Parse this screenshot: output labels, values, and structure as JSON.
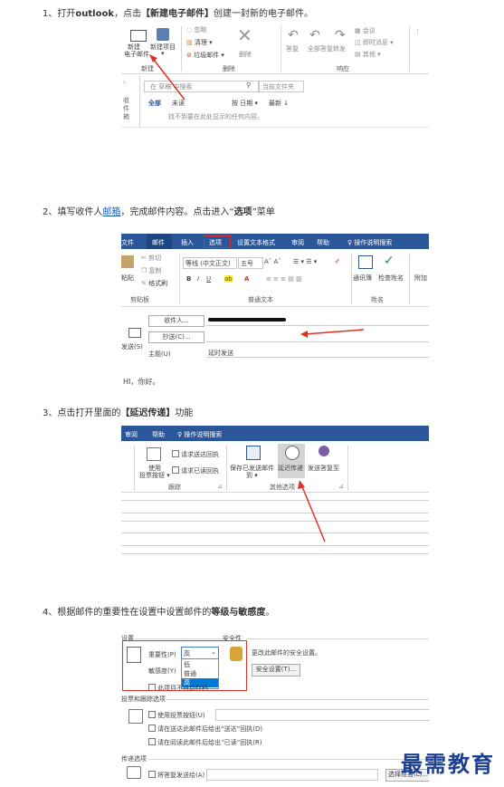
{
  "steps": [
    {
      "num": "1、",
      "pre": "打开",
      "b1": "outlook",
      "mid": "，点击",
      "b2": "【新建电子邮件】",
      "post": "创建一封新的电子邮件。"
    },
    {
      "num": "2、",
      "pre": "填写收件人",
      "link": "邮箱",
      "mid": "，完成邮件内容。点击进入“",
      "b1": "选项",
      "post": "”菜单"
    },
    {
      "num": "3、",
      "pre": "点击打开里面的",
      "b1": "【延迟传递】",
      "post": "功能"
    },
    {
      "num": "4、",
      "pre": "根据邮件的重要性在设置中设置邮件的",
      "b1": "等级与敏感度",
      "post": "。"
    }
  ],
  "shot1": {
    "new_email_l1": "新建",
    "new_email_l2": "电子邮件",
    "new_items_l1": "新建项目",
    "group_new": "新建",
    "ignore": "忽略",
    "cleanup": "清理",
    "junk": "垃圾邮件",
    "delete_label": "删除",
    "group_delete": "删除",
    "reply": "答复",
    "reply_all": "全部答复",
    "forward": "转发",
    "group_respond": "响应",
    "meeting": "会议",
    "im": "即时消息",
    "more": "其他",
    "inbox_vertical": "收件箱",
    "search_placeholder": "在 草稿 中搜索",
    "search_scope": "当前文件夹",
    "filter_all": "全部",
    "filter_unread": "未读",
    "sort_by": "按 日期",
    "sort_order": "最新",
    "empty_msg": "找不到要在此处显示的任何内容。"
  },
  "shot2": {
    "tabs": [
      "文件",
      "邮件",
      "插入",
      "选项",
      "设置文本格式",
      "审阅",
      "帮助"
    ],
    "tell_me": "操作说明搜索",
    "paste": "粘贴",
    "cut": "剪切",
    "copy": "复制",
    "format_painter": "格式刷",
    "font_name": "等线 (中文正文)",
    "font_size": "五号",
    "group_clipboard": "剪贴板",
    "group_basic_text": "普通文本",
    "address_book": "通讯簿",
    "check_names": "检查姓名",
    "group_names": "姓名",
    "attach": "附加",
    "to_btn": "收件人...",
    "cc_btn": "抄送(C)...",
    "send_lbl": "发送(S)",
    "subject_lbl": "主题(U)",
    "subject_val": "延时发送",
    "body_text": "HI，你好。"
  },
  "shot3": {
    "tabs": [
      "审阅",
      "帮助"
    ],
    "tell_me": "操作说明搜索",
    "use_vote_l1": "使用",
    "use_vote_l2": "投票按钮",
    "req_delivery": "请求送达回执",
    "req_read": "请求已读回执",
    "group_tracking": "跟踪",
    "save_sent_l1": "保存已发送邮件",
    "save_sent_l2": "到",
    "delay_delivery": "延迟传递",
    "direct_replies": "发送答复至",
    "group_more": "其他选项"
  },
  "shot4": {
    "settings": "设置",
    "security": "安全性",
    "importance_lbl": "重要性(P)",
    "importance_val": "高",
    "sensitivity_lbl": "敏感度(Y)",
    "options": [
      "低",
      "普通",
      "高"
    ],
    "security_desc": "更改此邮件的安全设置。",
    "security_btn": "安全设置(T)...",
    "not_autoarchive": "此项目不自动存档",
    "voting_section": "投票和跟踪选项",
    "use_voting": "使用投票按钮(U)",
    "req_delivery": "请在送达此邮件后给出“送达”回执(D)",
    "req_read": "请在阅读此邮件后给出“已读”回执(R)",
    "delivery_section": "传递选项",
    "have_replies": "将答复发送给(A)",
    "select_names": "选择姓名(L)..."
  },
  "watermark": "最需教育",
  "colors": {
    "accent": "#2b579a",
    "red": "#e0302a",
    "watermark": "#1d3f8f"
  }
}
